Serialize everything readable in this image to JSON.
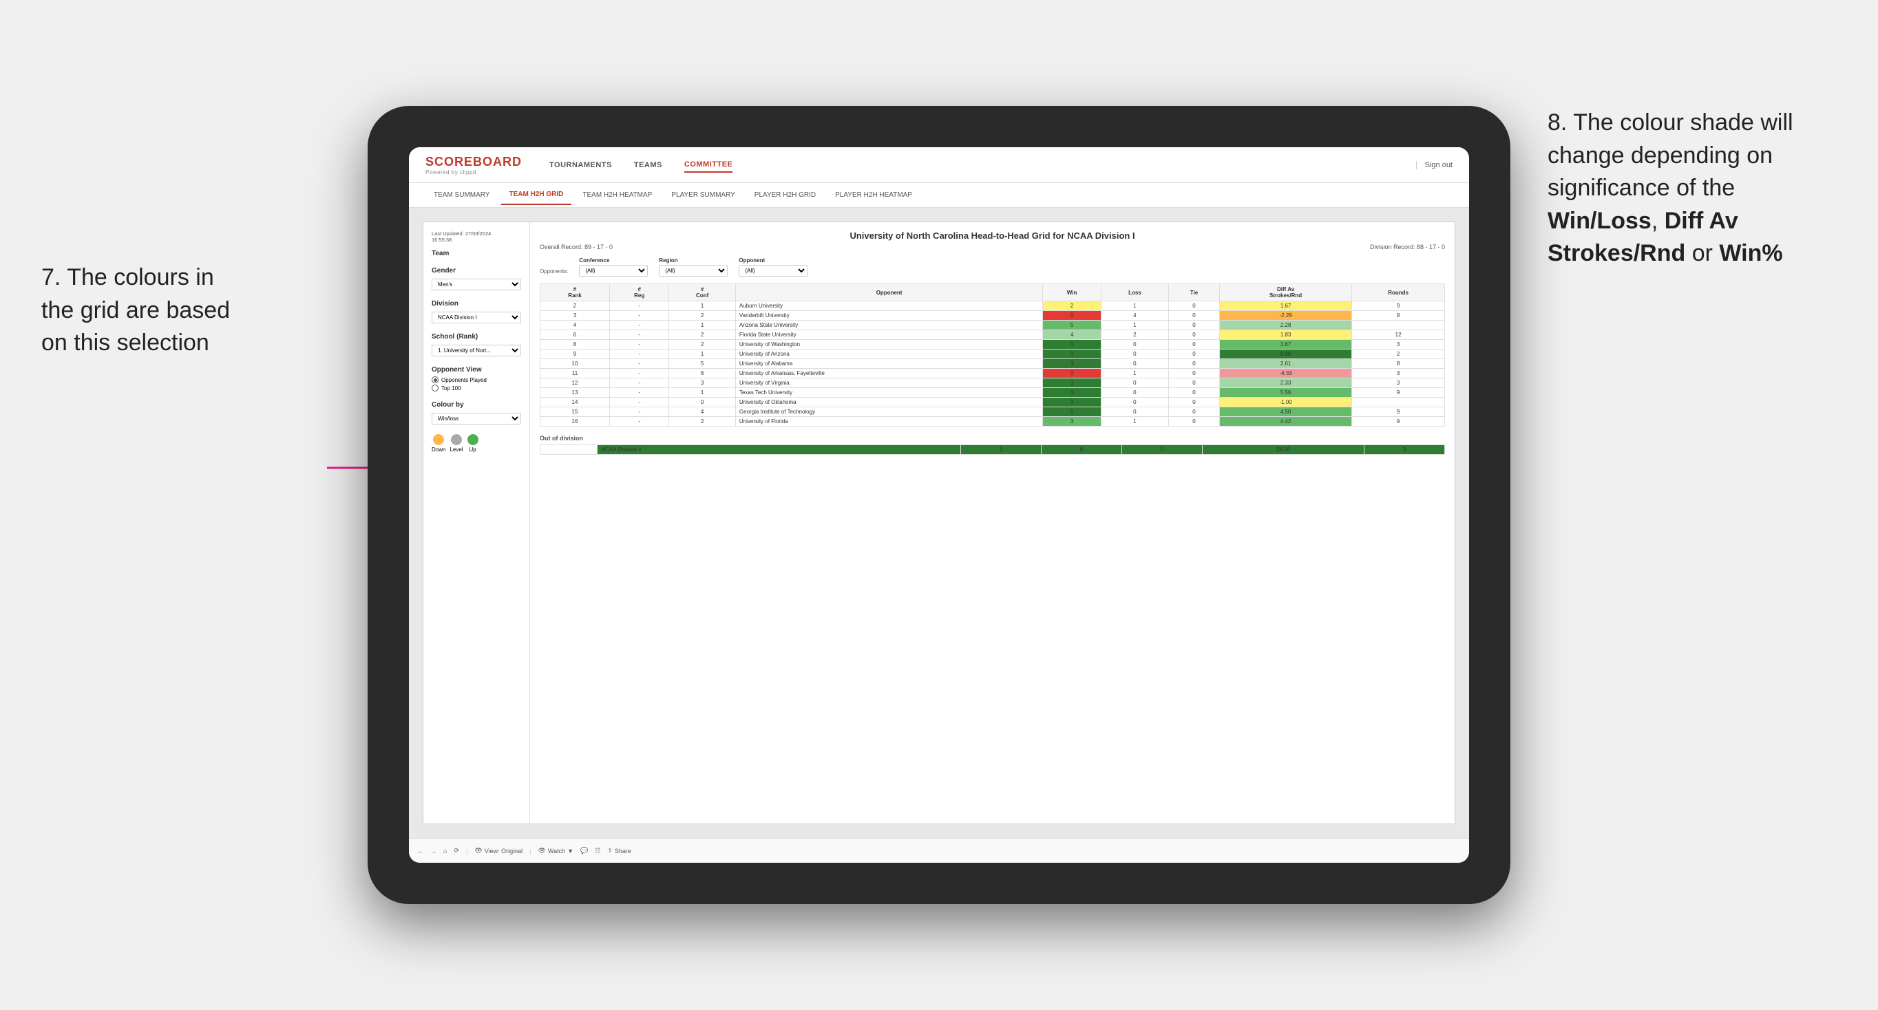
{
  "annotations": {
    "left_annotation": "7. The colours in the grid are based on this selection",
    "right_annotation_line1": "8. The colour shade will change depending on significance of the ",
    "right_bold1": "Win/Loss",
    "right_comma": ", ",
    "right_bold2": "Diff Av Strokes/Rnd",
    "right_or": " or ",
    "right_bold3": "Win%"
  },
  "header": {
    "logo": "SCOREBOARD",
    "logo_sub": "Powered by clippd",
    "nav": [
      "TOURNAMENTS",
      "TEAMS",
      "COMMITTEE"
    ],
    "active_nav": "COMMITTEE",
    "sign_out": "Sign out"
  },
  "sub_nav": {
    "tabs": [
      "TEAM SUMMARY",
      "TEAM H2H GRID",
      "TEAM H2H HEATMAP",
      "PLAYER SUMMARY",
      "PLAYER H2H GRID",
      "PLAYER H2H HEATMAP"
    ],
    "active_tab": "TEAM H2H GRID"
  },
  "sidebar": {
    "last_updated_label": "Last Updated: 27/03/2024",
    "last_updated_time": "16:55:38",
    "team_label": "Team",
    "gender_label": "Gender",
    "gender_value": "Men's",
    "division_label": "Division",
    "division_value": "NCAA Division I",
    "school_label": "School (Rank)",
    "school_value": "1. University of Nort...",
    "opponent_view_label": "Opponent View",
    "opponents_played": "Opponents Played",
    "top_100": "Top 100",
    "colour_by_label": "Colour by",
    "colour_by_value": "Win/loss",
    "legend": {
      "down_label": "Down",
      "level_label": "Level",
      "up_label": "Up"
    }
  },
  "grid": {
    "title": "University of North Carolina Head-to-Head Grid for NCAA Division I",
    "overall_record": "Overall Record: 89 - 17 - 0",
    "division_record": "Division Record: 88 - 17 - 0",
    "filters": {
      "conference_label": "Conference",
      "conference_value": "(All)",
      "region_label": "Region",
      "region_value": "(All)",
      "opponent_label": "Opponent",
      "opponent_value": "(All)",
      "opponents_label": "Opponents:"
    },
    "columns": [
      "#\nRank",
      "#\nReg",
      "#\nConf",
      "Opponent",
      "Win",
      "Loss",
      "Tie",
      "Diff Av\nStrokes/Rnd",
      "Rounds"
    ],
    "rows": [
      {
        "rank": "2",
        "reg": "-",
        "conf": "1",
        "opponent": "Auburn University",
        "win": "2",
        "loss": "1",
        "tie": "0",
        "diff": "1.67",
        "rounds": "9",
        "win_color": "c-yellow",
        "diff_color": "c-yellow"
      },
      {
        "rank": "3",
        "reg": "-",
        "conf": "2",
        "opponent": "Vanderbilt University",
        "win": "0",
        "loss": "4",
        "tie": "0",
        "diff": "-2.29",
        "rounds": "8",
        "win_color": "c-red-dark",
        "diff_color": "c-orange"
      },
      {
        "rank": "4",
        "reg": "-",
        "conf": "1",
        "opponent": "Arizona State University",
        "win": "5",
        "loss": "1",
        "tie": "0",
        "diff": "2.28",
        "rounds": "",
        "win_color": "c-green-mid",
        "diff_color": "c-green-light"
      },
      {
        "rank": "6",
        "reg": "-",
        "conf": "2",
        "opponent": "Florida State University",
        "win": "4",
        "loss": "2",
        "tie": "0",
        "diff": "1.83",
        "rounds": "12",
        "win_color": "c-green-light",
        "diff_color": "c-yellow"
      },
      {
        "rank": "8",
        "reg": "-",
        "conf": "2",
        "opponent": "University of Washington",
        "win": "1",
        "loss": "0",
        "tie": "0",
        "diff": "3.67",
        "rounds": "3",
        "win_color": "c-green-dark",
        "diff_color": "c-green-mid"
      },
      {
        "rank": "9",
        "reg": "-",
        "conf": "1",
        "opponent": "University of Arizona",
        "win": "1",
        "loss": "0",
        "tie": "0",
        "diff": "9.00",
        "rounds": "2",
        "win_color": "c-green-dark",
        "diff_color": "c-green-dark"
      },
      {
        "rank": "10",
        "reg": "-",
        "conf": "5",
        "opponent": "University of Alabama",
        "win": "3",
        "loss": "0",
        "tie": "0",
        "diff": "2.61",
        "rounds": "8",
        "win_color": "c-green-dark",
        "diff_color": "c-green-light"
      },
      {
        "rank": "11",
        "reg": "-",
        "conf": "6",
        "opponent": "University of Arkansas, Fayetteville",
        "win": "0",
        "loss": "1",
        "tie": "0",
        "diff": "-4.33",
        "rounds": "3",
        "win_color": "c-red-dark",
        "diff_color": "c-red"
      },
      {
        "rank": "12",
        "reg": "-",
        "conf": "3",
        "opponent": "University of Virginia",
        "win": "1",
        "loss": "0",
        "tie": "0",
        "diff": "2.33",
        "rounds": "3",
        "win_color": "c-green-dark",
        "diff_color": "c-green-light"
      },
      {
        "rank": "13",
        "reg": "-",
        "conf": "1",
        "opponent": "Texas Tech University",
        "win": "3",
        "loss": "0",
        "tie": "0",
        "diff": "5.56",
        "rounds": "9",
        "win_color": "c-green-dark",
        "diff_color": "c-green-mid"
      },
      {
        "rank": "14",
        "reg": "-",
        "conf": "0",
        "opponent": "University of Oklahoma",
        "win": "1",
        "loss": "0",
        "tie": "0",
        "diff": "-1.00",
        "rounds": "",
        "win_color": "c-green-dark",
        "diff_color": "c-yellow"
      },
      {
        "rank": "15",
        "reg": "-",
        "conf": "4",
        "opponent": "Georgia Institute of Technology",
        "win": "5",
        "loss": "0",
        "tie": "0",
        "diff": "4.50",
        "rounds": "9",
        "win_color": "c-green-dark",
        "diff_color": "c-green-mid"
      },
      {
        "rank": "16",
        "reg": "-",
        "conf": "2",
        "opponent": "University of Florida",
        "win": "3",
        "loss": "1",
        "tie": "0",
        "diff": "4.42",
        "rounds": "9",
        "win_color": "c-green-mid",
        "diff_color": "c-green-mid"
      }
    ],
    "out_of_division": {
      "label": "Out of division",
      "row": {
        "division": "NCAA Division II",
        "win": "1",
        "loss": "0",
        "tie": "0",
        "diff": "26.00",
        "rounds": "3",
        "win_color": "c-green-dark",
        "diff_color": "c-green-dark"
      }
    }
  },
  "toolbar": {
    "view_label": "View: Original",
    "watch_label": "Watch",
    "share_label": "Share"
  }
}
